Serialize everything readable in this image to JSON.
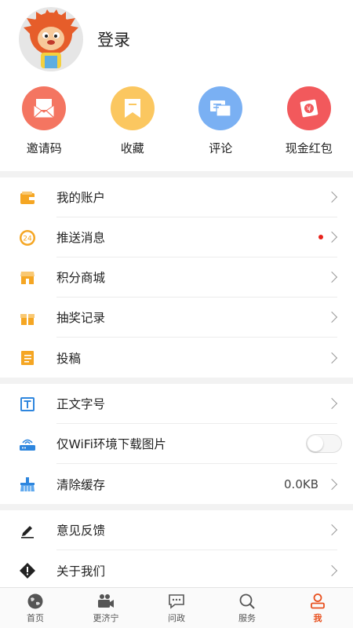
{
  "profile": {
    "login_label": "登录"
  },
  "quick_actions": [
    {
      "label": "邀请码",
      "icon": "envelope-icon",
      "color": "#f47561"
    },
    {
      "label": "收藏",
      "icon": "bookmark-icon",
      "color": "#fbc760"
    },
    {
      "label": "评论",
      "icon": "comment-icon",
      "color": "#7ab0f3"
    },
    {
      "label": "现金红包",
      "icon": "red-packet-icon",
      "color": "#f2595c"
    }
  ],
  "menu_group1": [
    {
      "label": "我的账户",
      "icon": "wallet-icon"
    },
    {
      "label": "推送消息",
      "icon": "clock-24-icon",
      "has_dot": true
    },
    {
      "label": "积分商城",
      "icon": "store-icon"
    },
    {
      "label": "抽奖记录",
      "icon": "gift-icon"
    },
    {
      "label": "投稿",
      "icon": "document-icon"
    }
  ],
  "menu_group2": [
    {
      "label": "正文字号",
      "icon": "font-size-icon"
    },
    {
      "label": "仅WiFi环境下载图片",
      "icon": "router-icon",
      "toggle_on": false
    },
    {
      "label": "清除缓存",
      "icon": "broom-icon",
      "value": "0.0KB"
    }
  ],
  "menu_group3": [
    {
      "label": "意见反馈",
      "icon": "pencil-icon"
    },
    {
      "label": "关于我们",
      "icon": "info-diamond-icon"
    }
  ],
  "bottom_nav": [
    {
      "label": "首页",
      "icon": "globe-icon"
    },
    {
      "label": "更济宁",
      "icon": "video-camera-icon"
    },
    {
      "label": "问政",
      "icon": "chat-bubble-icon"
    },
    {
      "label": "服务",
      "icon": "search-icon"
    },
    {
      "label": "我",
      "icon": "person-icon",
      "active": true
    }
  ],
  "colors": {
    "accent": "#e8501e",
    "icon_orange": "#f5a623",
    "icon_blue": "#2e86de",
    "dot_red": "#e8221b"
  }
}
